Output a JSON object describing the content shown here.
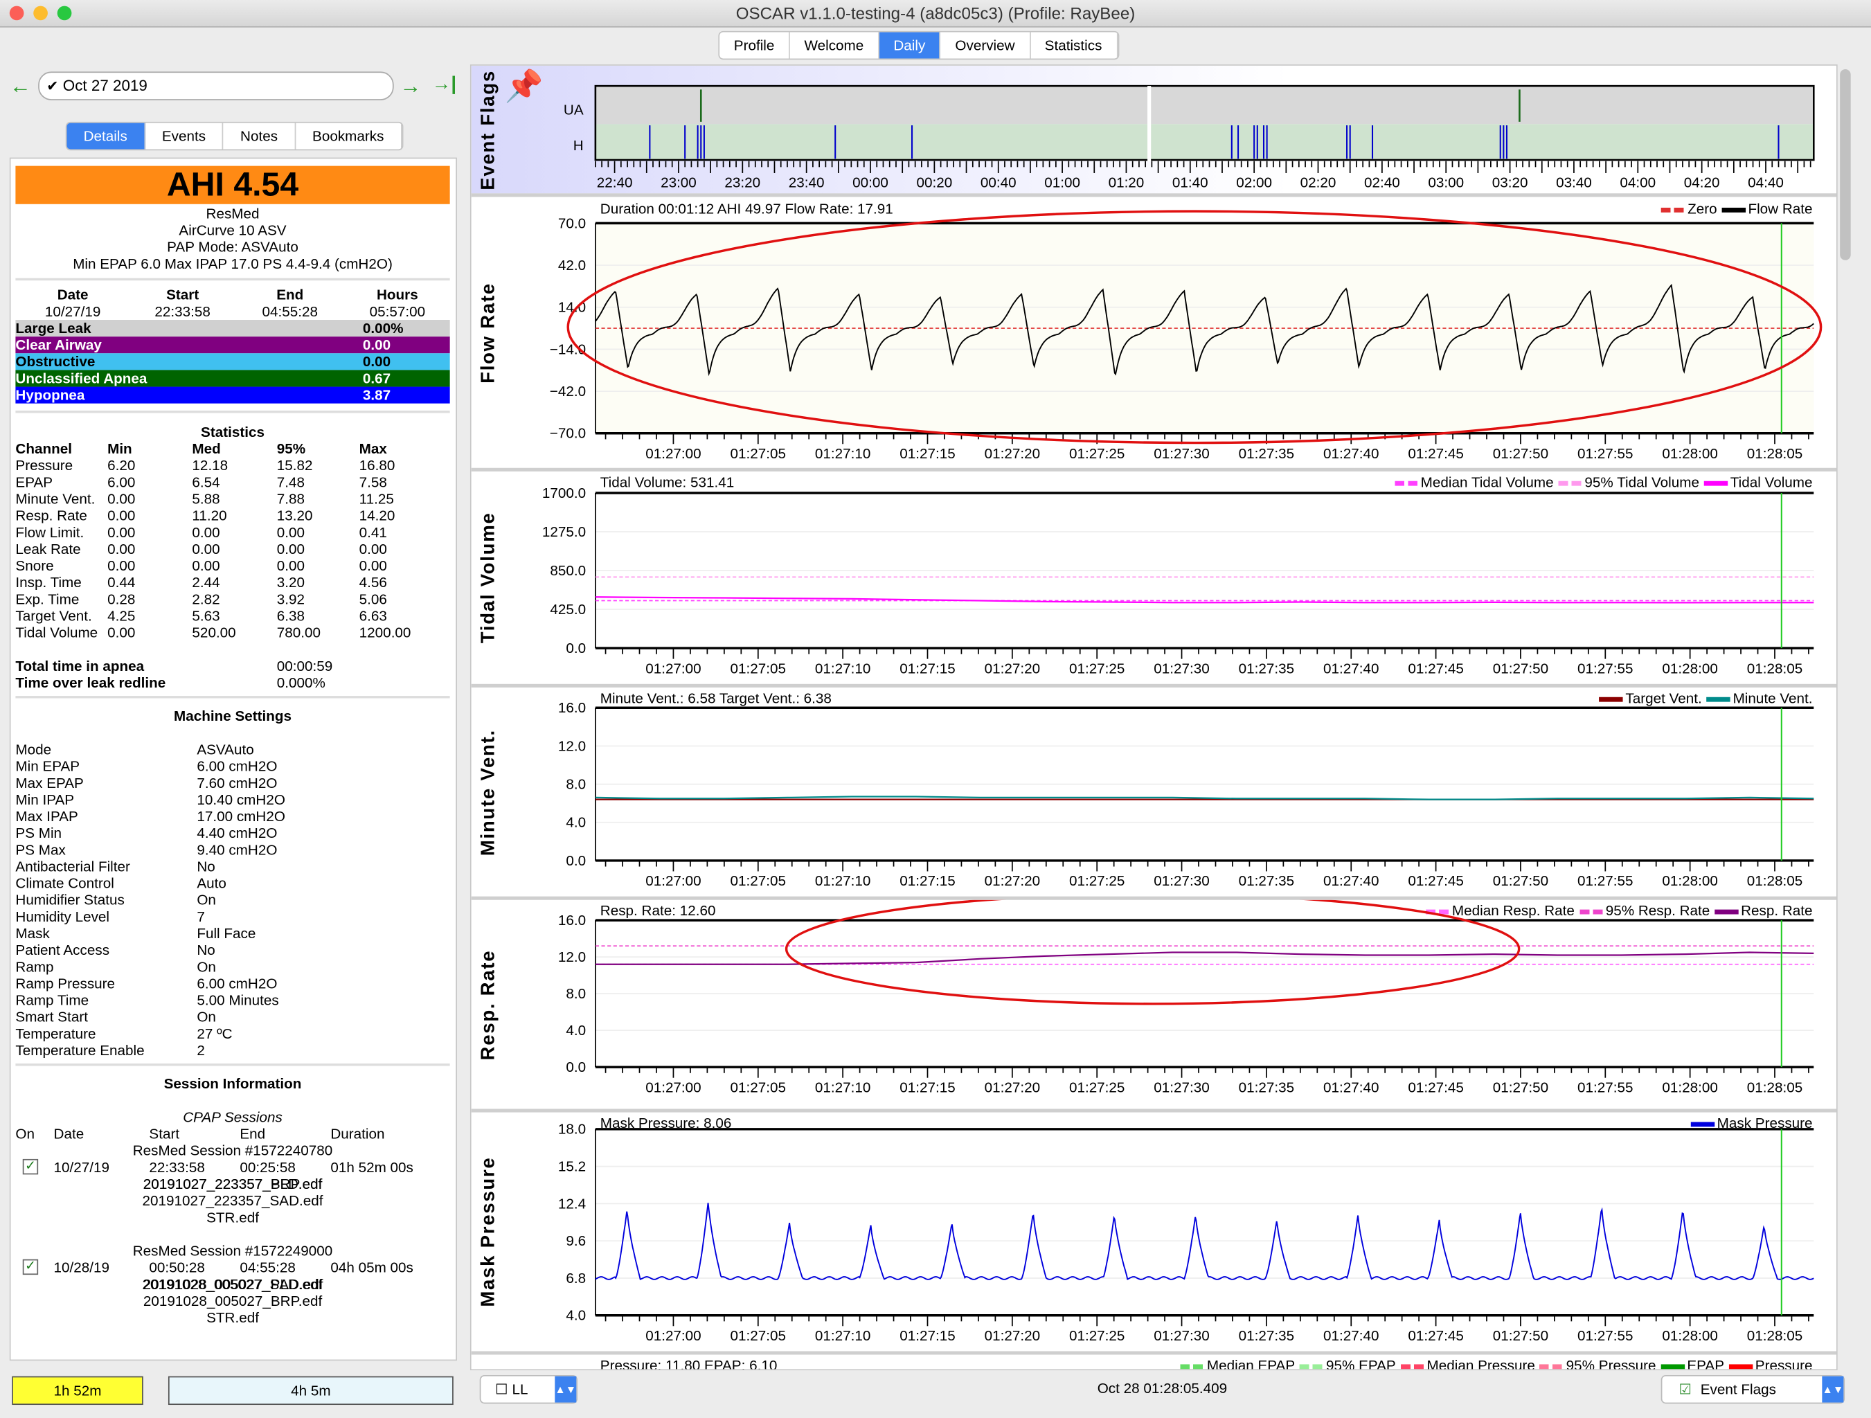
{
  "window": {
    "title": "OSCAR v1.1.0-testing-4 (a8dc05c3) (Profile: RayBee)"
  },
  "main_tabs": [
    {
      "label": "Profile"
    },
    {
      "label": "Welcome"
    },
    {
      "label": "Daily",
      "active": true
    },
    {
      "label": "Overview"
    },
    {
      "label": "Statistics"
    }
  ],
  "nav": {
    "date": "Oct 27 2019",
    "back_icon": "arrow-left-icon",
    "forward_icon": "arrow-right-icon",
    "last_icon": "skip-to-end-icon"
  },
  "sub_tabs": [
    {
      "label": "Details",
      "active": true
    },
    {
      "label": "Events"
    },
    {
      "label": "Notes"
    },
    {
      "label": "Bookmarks"
    }
  ],
  "summary": {
    "ahi": "AHI 4.54",
    "brand": "ResMed",
    "model": "AirCurve 10 ASV",
    "mode": "PAP Mode: ASVAuto",
    "pressure": "Min EPAP 6.0 Max IPAP 17.0 PS 4.4-9.4 (cmH2O)"
  },
  "session_header": {
    "cols": [
      "Date",
      "Start",
      "End",
      "Hours"
    ],
    "values": [
      "10/27/19",
      "22:33:58",
      "04:55:28",
      "05:57:00"
    ]
  },
  "indices": [
    {
      "label": "Large Leak",
      "value": "0.00%",
      "bg": "#d0d0d0",
      "fg": "#000000"
    },
    {
      "label": "Clear Airway",
      "value": "0.00",
      "bg": "#800080",
      "fg": "#ffffff"
    },
    {
      "label": "Obstructive",
      "value": "0.00",
      "bg": "#40c0f0",
      "fg": "#000000"
    },
    {
      "label": "Unclassified Apnea",
      "value": "0.67",
      "bg": "#006400",
      "fg": "#ffffff"
    },
    {
      "label": "Hypopnea",
      "value": "3.87",
      "bg": "#0000ff",
      "fg": "#ffffff"
    }
  ],
  "statistics": {
    "title": "Statistics",
    "cols": [
      "Channel",
      "Min",
      "Med",
      "95%",
      "Max"
    ],
    "rows": [
      [
        "Pressure",
        "6.20",
        "12.18",
        "15.82",
        "16.80"
      ],
      [
        "EPAP",
        "6.00",
        "6.54",
        "7.48",
        "7.58"
      ],
      [
        "Minute Vent.",
        "0.00",
        "5.88",
        "7.88",
        "11.25"
      ],
      [
        "Resp. Rate",
        "0.00",
        "11.20",
        "13.20",
        "14.20"
      ],
      [
        "Flow Limit.",
        "0.00",
        "0.00",
        "0.00",
        "0.41"
      ],
      [
        "Leak Rate",
        "0.00",
        "0.00",
        "0.00",
        "0.00"
      ],
      [
        "Snore",
        "0.00",
        "0.00",
        "0.00",
        "0.00"
      ],
      [
        "Insp. Time",
        "0.44",
        "2.44",
        "3.20",
        "4.56"
      ],
      [
        "Exp. Time",
        "0.28",
        "2.82",
        "3.92",
        "5.06"
      ],
      [
        "Target Vent.",
        "4.25",
        "5.63",
        "6.38",
        "6.63"
      ],
      [
        "Tidal Volume",
        "0.00",
        "520.00",
        "780.00",
        "1200.00"
      ]
    ]
  },
  "totals": [
    {
      "label": "Total time in apnea",
      "value": "00:00:59"
    },
    {
      "label": "Time over leak redline",
      "value": "0.000%"
    }
  ],
  "machine_settings": {
    "title": "Machine Settings",
    "rows": [
      [
        "Mode",
        "ASVAuto"
      ],
      [
        "Min EPAP",
        "6.00 cmH2O"
      ],
      [
        "Max EPAP",
        "7.60 cmH2O"
      ],
      [
        "Min IPAP",
        "10.40 cmH2O"
      ],
      [
        "Max IPAP",
        "17.00 cmH2O"
      ],
      [
        "PS Min",
        "4.40 cmH2O"
      ],
      [
        "PS Max",
        "9.40 cmH2O"
      ],
      [
        "Antibacterial Filter",
        "No"
      ],
      [
        "Climate Control",
        "Auto"
      ],
      [
        "Humidifier Status",
        "On"
      ],
      [
        "Humidity Level",
        "7"
      ],
      [
        "Mask",
        "Full Face"
      ],
      [
        "Patient Access",
        "No"
      ],
      [
        "Ramp",
        "On"
      ],
      [
        "Ramp Pressure",
        "6.00 cmH2O"
      ],
      [
        "Ramp Time",
        "5.00 Minutes"
      ],
      [
        "Smart Start",
        "On"
      ],
      [
        "Temperature",
        "27 ºC"
      ],
      [
        "Temperature Enable",
        "2"
      ]
    ]
  },
  "session_info": {
    "title": "Session Information",
    "subtitle": "CPAP Sessions",
    "cols": [
      "On",
      "Date",
      "Start",
      "End",
      "Duration"
    ],
    "sessions": [
      {
        "name": "ResMed Session #1572240780",
        "checked": true,
        "date": "10/27/19",
        "start": "22:33:58",
        "end": "00:25:58",
        "duration": "01h 52m 00s",
        "files": [
          "20191027_223357_PLD.edf",
          "20191027_223357_BRP.edf",
          "20191027_223357_SAD.edf",
          "STR.edf"
        ]
      },
      {
        "name": "ResMed Session #1572249000",
        "checked": true,
        "date": "10/28/19",
        "start": "00:50:28",
        "end": "04:55:28",
        "duration": "04h 05m 00s",
        "files": [
          "20191028_005027_SAD.edf",
          "20191028_005027_PLD.edf",
          "20191028_005027_BRP.edf",
          "STR.edf"
        ]
      }
    ]
  },
  "duration_bars": [
    {
      "label": "1h 52m",
      "color": "#ffff33"
    },
    {
      "label": "4h 5m",
      "color": "#e8f6fb"
    }
  ],
  "bottom": {
    "layout_check": "LL",
    "cursor_time": "Oct 28 01:28:05.409",
    "graph_select": "Event Flags"
  },
  "colors": {
    "accent": "#3b82f0",
    "cursor": "#22cc22",
    "annotation": "#e01010"
  },
  "chart_data": [
    {
      "id": "event_flags",
      "type": "timeline",
      "ylabel": "Event Flags",
      "icon": "pushpin-icon",
      "rows": [
        "UA",
        "H"
      ],
      "xticks": [
        "22:40",
        "23:00",
        "23:20",
        "23:40",
        "00:00",
        "00:20",
        "00:40",
        "01:00",
        "01:20",
        "01:40",
        "02:00",
        "02:20",
        "02:40",
        "03:00",
        "03:20",
        "03:40",
        "04:00",
        "04:20",
        "04:40"
      ],
      "xrange": [
        "22:34",
        "04:55"
      ],
      "selection": "01:27",
      "events": {
        "UA": [
          "23:07",
          "03:23"
        ],
        "H": [
          "22:51",
          "23:02",
          "23:06",
          "23:07",
          "23:08",
          "23:49",
          "00:13",
          "01:53",
          "01:55",
          "02:00",
          "02:01",
          "02:03",
          "02:04",
          "02:29",
          "02:30",
          "02:37",
          "03:17",
          "03:18",
          "03:19",
          "04:44"
        ]
      }
    },
    {
      "id": "flow_rate",
      "type": "line",
      "ylabel": "Flow Rate",
      "title": "Duration 00:01:12 AHI 49.97 Flow Rate: 17.91",
      "ylim": [
        -70,
        70
      ],
      "yticks": [
        "70.0",
        "42.0",
        "14.0",
        "−14.0",
        "−42.0",
        "−70.0"
      ],
      "legend": [
        {
          "name": "Zero",
          "color": "#e03030",
          "dashed": true
        },
        {
          "name": "Flow Rate",
          "color": "#000000"
        }
      ],
      "breath_peaks": [
        24,
        22,
        26,
        22,
        20,
        22,
        25,
        24,
        20,
        26,
        22,
        22,
        24,
        28,
        20
      ],
      "breath_troughs": [
        -27,
        -31,
        -29,
        -28,
        -24,
        -26,
        -32,
        -30,
        -24,
        -26,
        -28,
        -28,
        -25,
        -30,
        -28
      ],
      "zero": 0
    },
    {
      "id": "tidal_volume",
      "type": "line",
      "ylabel": "Tidal Volume",
      "title": "Tidal Volume: 531.41",
      "ylim": [
        0,
        1700
      ],
      "yticks": [
        "1700.0",
        "1275.0",
        "850.0",
        "425.0",
        "0.0"
      ],
      "legend": [
        {
          "name": "Median Tidal Volume",
          "color": "#ff40ff",
          "dashed": true
        },
        {
          "name": "95% Tidal Volume",
          "color": "#ff99ee",
          "dashed": true
        },
        {
          "name": "Tidal Volume",
          "color": "#ff00ff"
        }
      ],
      "values": [
        560,
        555,
        550,
        545,
        540,
        530,
        520,
        510,
        505,
        500,
        500,
        505,
        500,
        500,
        502,
        500,
        500,
        498,
        500,
        500
      ],
      "median": 520,
      "p95": 780
    },
    {
      "id": "minute_vent",
      "type": "line",
      "ylabel": "Minute Vent.",
      "title": "Minute Vent.: 6.58 Target Vent.: 6.38",
      "ylim": [
        0,
        16
      ],
      "yticks": [
        "16.0",
        "12.0",
        "8.0",
        "4.0",
        "0.0"
      ],
      "legend": [
        {
          "name": "Target Vent.",
          "color": "#8b0000"
        },
        {
          "name": "Minute Vent.",
          "color": "#008b8b"
        }
      ],
      "values": [
        6.6,
        6.5,
        6.5,
        6.6,
        6.7,
        6.7,
        6.6,
        6.6,
        6.6,
        6.6,
        6.5,
        6.5,
        6.5,
        6.4,
        6.4,
        6.5,
        6.5,
        6.5,
        6.6,
        6.5
      ],
      "target": [
        6.4,
        6.4,
        6.4,
        6.4,
        6.4,
        6.4,
        6.4,
        6.4,
        6.4,
        6.4,
        6.4,
        6.4,
        6.4,
        6.4,
        6.4,
        6.4,
        6.4,
        6.4,
        6.4,
        6.4
      ]
    },
    {
      "id": "resp_rate",
      "type": "line",
      "ylabel": "Resp. Rate",
      "title": "Resp. Rate: 12.60",
      "ylim": [
        0,
        16
      ],
      "yticks": [
        "16.0",
        "12.0",
        "8.0",
        "4.0",
        "0.0"
      ],
      "legend": [
        {
          "name": "Median Resp. Rate",
          "color": "#ff66ff",
          "dashed": true
        },
        {
          "name": "95% Resp. Rate",
          "color": "#ee44cc",
          "dashed": true
        },
        {
          "name": "Resp. Rate",
          "color": "#800080"
        }
      ],
      "values": [
        11.2,
        11.2,
        11.2,
        11.2,
        11.3,
        11.4,
        11.8,
        12.1,
        12.3,
        12.5,
        12.5,
        12.3,
        12.2,
        12.2,
        12.3,
        12.2,
        12.2,
        12.3,
        12.5,
        12.4
      ],
      "median": 11.2,
      "p95": 13.2
    },
    {
      "id": "mask_pressure",
      "type": "line",
      "ylabel": "Mask Pressure",
      "title": "Mask Pressure: 8.06",
      "ylim": [
        4,
        18
      ],
      "yticks": [
        "18.0",
        "15.2",
        "12.4",
        "9.6",
        "6.8",
        "4.0"
      ],
      "legend": [
        {
          "name": "Mask Pressure",
          "color": "#0000dd"
        }
      ],
      "breath_peaks": [
        12.0,
        12.6,
        11.0,
        10.8,
        11.0,
        11.8,
        11.6,
        11.6,
        11.2,
        11.6,
        11.2,
        11.8,
        12.2,
        12.0,
        10.8
      ],
      "baseline": 6.8
    },
    {
      "id": "pressure",
      "type": "line",
      "title": "Pressure: 11.80 EPAP: 6.10",
      "legend": [
        {
          "name": "Median EPAP",
          "color": "#66dd66",
          "dashed": true
        },
        {
          "name": "95% EPAP",
          "color": "#99ee99",
          "dashed": true
        },
        {
          "name": "Median Pressure",
          "color": "#ff4466",
          "dashed": true
        },
        {
          "name": "95% Pressure",
          "color": "#ff7799",
          "dashed": true
        },
        {
          "name": "EPAP",
          "color": "#009900"
        },
        {
          "name": "Pressure",
          "color": "#ff0000"
        }
      ]
    }
  ],
  "zoom_xaxis": {
    "ticks": [
      "01:27:00",
      "01:27:05",
      "01:27:10",
      "01:27:15",
      "01:27:20",
      "01:27:25",
      "01:27:30",
      "01:27:35",
      "01:27:40",
      "01:27:45",
      "01:27:50",
      "01:27:55",
      "01:28:00",
      "01:28:05"
    ],
    "range_seconds": [
      -4.6,
      67.3
    ],
    "cursor_seconds": 65.4
  }
}
